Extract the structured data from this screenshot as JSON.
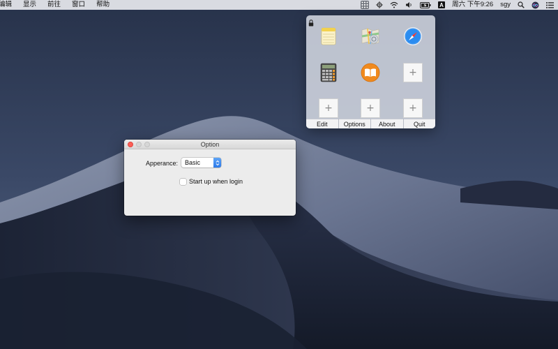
{
  "menubar": {
    "left_items": [
      "编辑",
      "显示",
      "前往",
      "窗口",
      "帮助"
    ],
    "right": {
      "grid_icon": "grid-icon",
      "icons": [
        "sync-icon",
        "wifi-icon",
        "volume-icon",
        "battery-icon"
      ],
      "input_source": "A",
      "clock": "周六 下午9:26",
      "user": "sgy",
      "search_icon": "search-icon",
      "siri_icon": "siri-icon",
      "menu_icon": "list-icon"
    }
  },
  "popover": {
    "lock_icon": "lock-icon",
    "apps": [
      {
        "name": "notes-icon"
      },
      {
        "name": "maps-icon"
      },
      {
        "name": "safari-icon"
      },
      {
        "name": "calculator-icon"
      },
      {
        "name": "ibooks-icon"
      },
      {
        "name": "empty-slot",
        "label": "+"
      },
      {
        "name": "empty-slot",
        "label": "+"
      },
      {
        "name": "empty-slot",
        "label": "+"
      },
      {
        "name": "empty-slot",
        "label": "+"
      }
    ],
    "toolbar": [
      "Edit",
      "Options",
      "About",
      "Quit"
    ]
  },
  "window": {
    "title": "Option",
    "appearance_label": "Apperance:",
    "appearance_value": "Basic",
    "checkbox_label": "Start up when login",
    "checkbox_checked": false
  },
  "colors": {
    "close": "#fc5f57",
    "accent": "#2b79ea"
  }
}
